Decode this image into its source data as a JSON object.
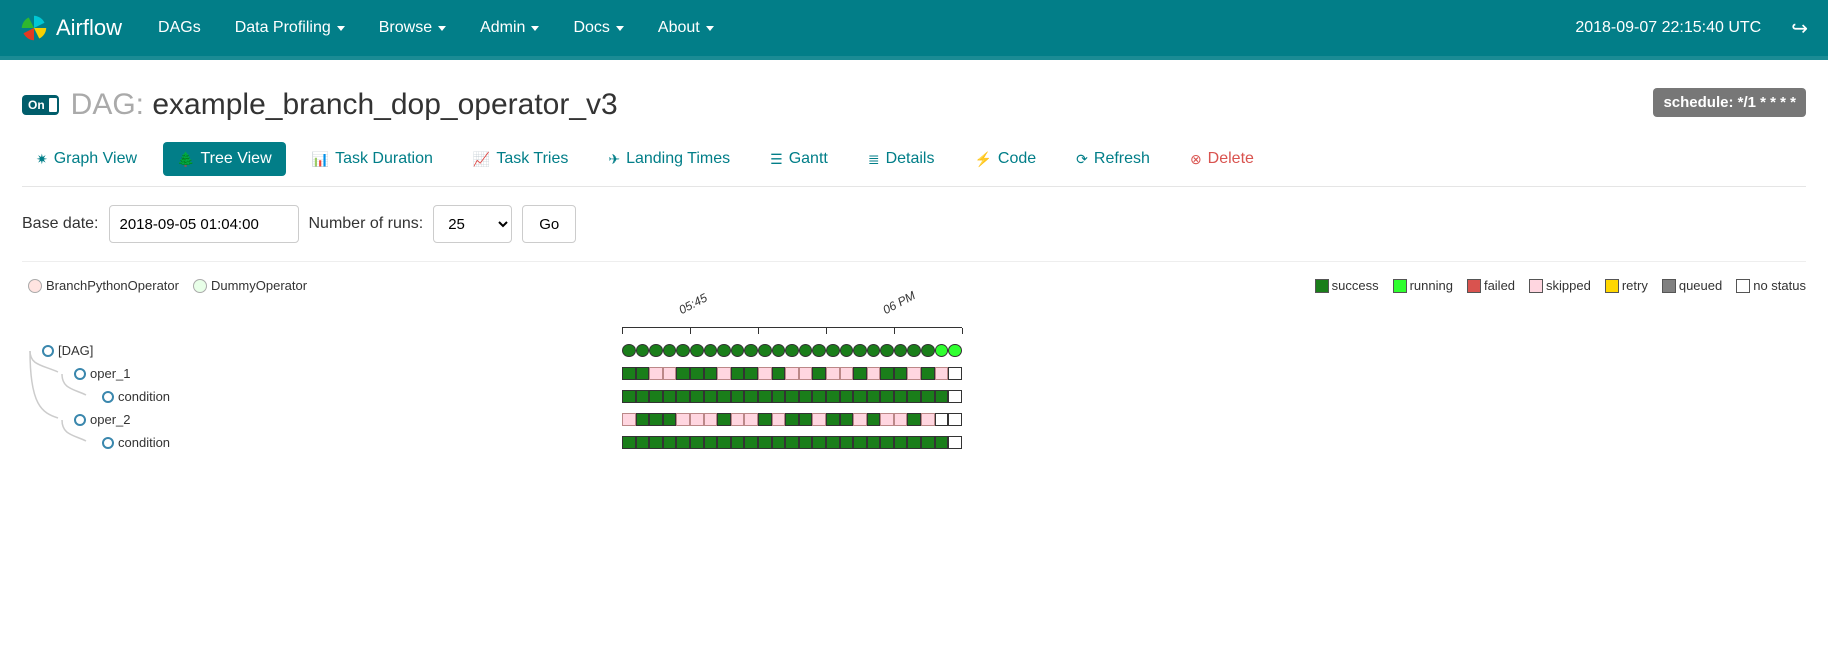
{
  "brand": "Airflow",
  "nav": {
    "items": [
      "DAGs",
      "Data Profiling",
      "Browse",
      "Admin",
      "Docs",
      "About"
    ],
    "dropdown_flags": [
      false,
      true,
      true,
      true,
      true,
      true
    ],
    "timestamp": "2018-09-07 22:15:40 UTC"
  },
  "dag": {
    "on_label": "On",
    "prefix": "DAG:",
    "name": "example_branch_dop_operator_v3",
    "schedule_label": "schedule: */1 * * * *"
  },
  "tabs": [
    {
      "glyph": "✷",
      "label": "Graph View",
      "active": false,
      "danger": false
    },
    {
      "glyph": "🌲",
      "label": "Tree View",
      "active": true,
      "danger": false
    },
    {
      "glyph": "📊",
      "label": "Task Duration",
      "active": false,
      "danger": false
    },
    {
      "glyph": "📈",
      "label": "Task Tries",
      "active": false,
      "danger": false
    },
    {
      "glyph": "✈",
      "label": "Landing Times",
      "active": false,
      "danger": false
    },
    {
      "glyph": "☰",
      "label": "Gantt",
      "active": false,
      "danger": false
    },
    {
      "glyph": "≣",
      "label": "Details",
      "active": false,
      "danger": false
    },
    {
      "glyph": "⚡",
      "label": "Code",
      "active": false,
      "danger": false
    },
    {
      "glyph": "⟳",
      "label": "Refresh",
      "active": false,
      "danger": false
    },
    {
      "glyph": "⊗",
      "label": "Delete",
      "active": false,
      "danger": true
    }
  ],
  "controls": {
    "base_date_label": "Base date:",
    "base_date_value": "2018-09-05 01:04:00",
    "num_runs_label": "Number of runs:",
    "num_runs_value": "25",
    "go_label": "Go"
  },
  "operators": [
    {
      "name": "BranchPythonOperator",
      "color": "#ffe4e1"
    },
    {
      "name": "DummyOperator",
      "color": "#e8ffe8"
    }
  ],
  "states": [
    {
      "name": "success",
      "color": "#1a7e1a"
    },
    {
      "name": "running",
      "color": "#2fff2f"
    },
    {
      "name": "failed",
      "color": "#d9534f"
    },
    {
      "name": "skipped",
      "color": "#ffd6e0"
    },
    {
      "name": "retry",
      "color": "#ffd700"
    },
    {
      "name": "queued",
      "color": "#808080"
    },
    {
      "name": "no status",
      "color": "#ffffff"
    }
  ],
  "time_labels": [
    {
      "text": "05:45",
      "x_percent": 18
    },
    {
      "text": "06 PM",
      "x_percent": 78
    }
  ],
  "tasks": [
    "[DAG]",
    "oper_1",
    "condition",
    "oper_2",
    "condition"
  ],
  "chart_data": {
    "type": "table",
    "description": "Tree view task-instance status grid. Columns are DAG runs (25 runs, ~1-minute schedule around 2018-09-07 17:45–18:00). Rows are task hierarchy. Cell values are task states.",
    "legend_states": [
      "success",
      "running",
      "failed",
      "skipped",
      "retry",
      "queued",
      "no status"
    ],
    "rows": [
      {
        "task": "[DAG]",
        "shape": "circle",
        "cells": [
          "success",
          "success",
          "success",
          "success",
          "success",
          "success",
          "success",
          "success",
          "success",
          "success",
          "success",
          "success",
          "success",
          "success",
          "success",
          "success",
          "success",
          "success",
          "success",
          "success",
          "success",
          "success",
          "success",
          "running",
          "running"
        ]
      },
      {
        "task": "oper_1",
        "shape": "square",
        "cells": [
          "success",
          "success",
          "skipped",
          "skipped",
          "success",
          "success",
          "success",
          "skipped",
          "success",
          "success",
          "skipped",
          "success",
          "skipped",
          "skipped",
          "success",
          "skipped",
          "skipped",
          "success",
          "skipped",
          "success",
          "success",
          "skipped",
          "success",
          "skipped",
          "nostatus"
        ]
      },
      {
        "task": "condition (under oper_1)",
        "shape": "square",
        "cells": [
          "success",
          "success",
          "success",
          "success",
          "success",
          "success",
          "success",
          "success",
          "success",
          "success",
          "success",
          "success",
          "success",
          "success",
          "success",
          "success",
          "success",
          "success",
          "success",
          "success",
          "success",
          "success",
          "success",
          "success",
          "nostatus"
        ]
      },
      {
        "task": "oper_2",
        "shape": "square",
        "cells": [
          "skipped",
          "success",
          "success",
          "success",
          "skipped",
          "skipped",
          "skipped",
          "success",
          "skipped",
          "skipped",
          "success",
          "skipped",
          "success",
          "success",
          "skipped",
          "success",
          "success",
          "skipped",
          "success",
          "skipped",
          "skipped",
          "success",
          "skipped",
          "nostatus",
          "nostatus"
        ]
      },
      {
        "task": "condition (under oper_2)",
        "shape": "square",
        "cells": [
          "success",
          "success",
          "success",
          "success",
          "success",
          "success",
          "success",
          "success",
          "success",
          "success",
          "success",
          "success",
          "success",
          "success",
          "success",
          "success",
          "success",
          "success",
          "success",
          "success",
          "success",
          "success",
          "success",
          "success",
          "nostatus"
        ]
      }
    ]
  }
}
